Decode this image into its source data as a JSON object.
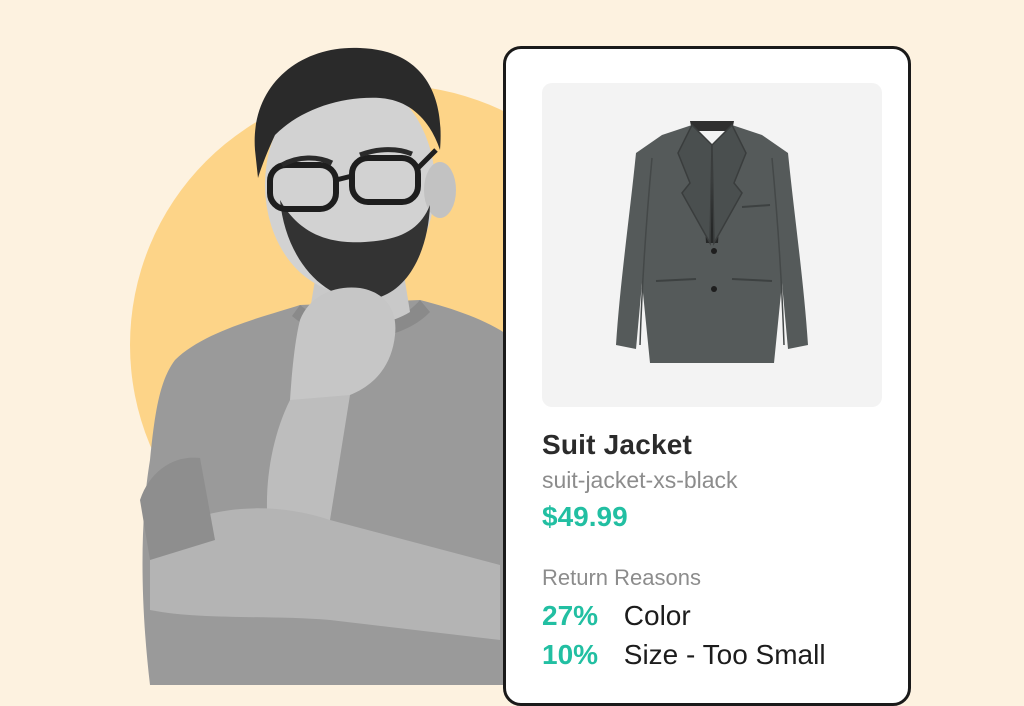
{
  "product": {
    "name": "Suit Jacket",
    "sku": "suit-jacket-xs-black",
    "price": "$49.99",
    "image_icon": "jacket-icon"
  },
  "return_reasons": {
    "heading": "Return Reasons",
    "items": [
      {
        "percent": "27%",
        "reason": "Color"
      },
      {
        "percent": "10%",
        "reason": "Size - Too Small"
      }
    ]
  },
  "colors": {
    "background": "#fdf2e0",
    "circle": "#fdd488",
    "accent": "#22bfa2",
    "card_border": "#1a1a1a"
  }
}
